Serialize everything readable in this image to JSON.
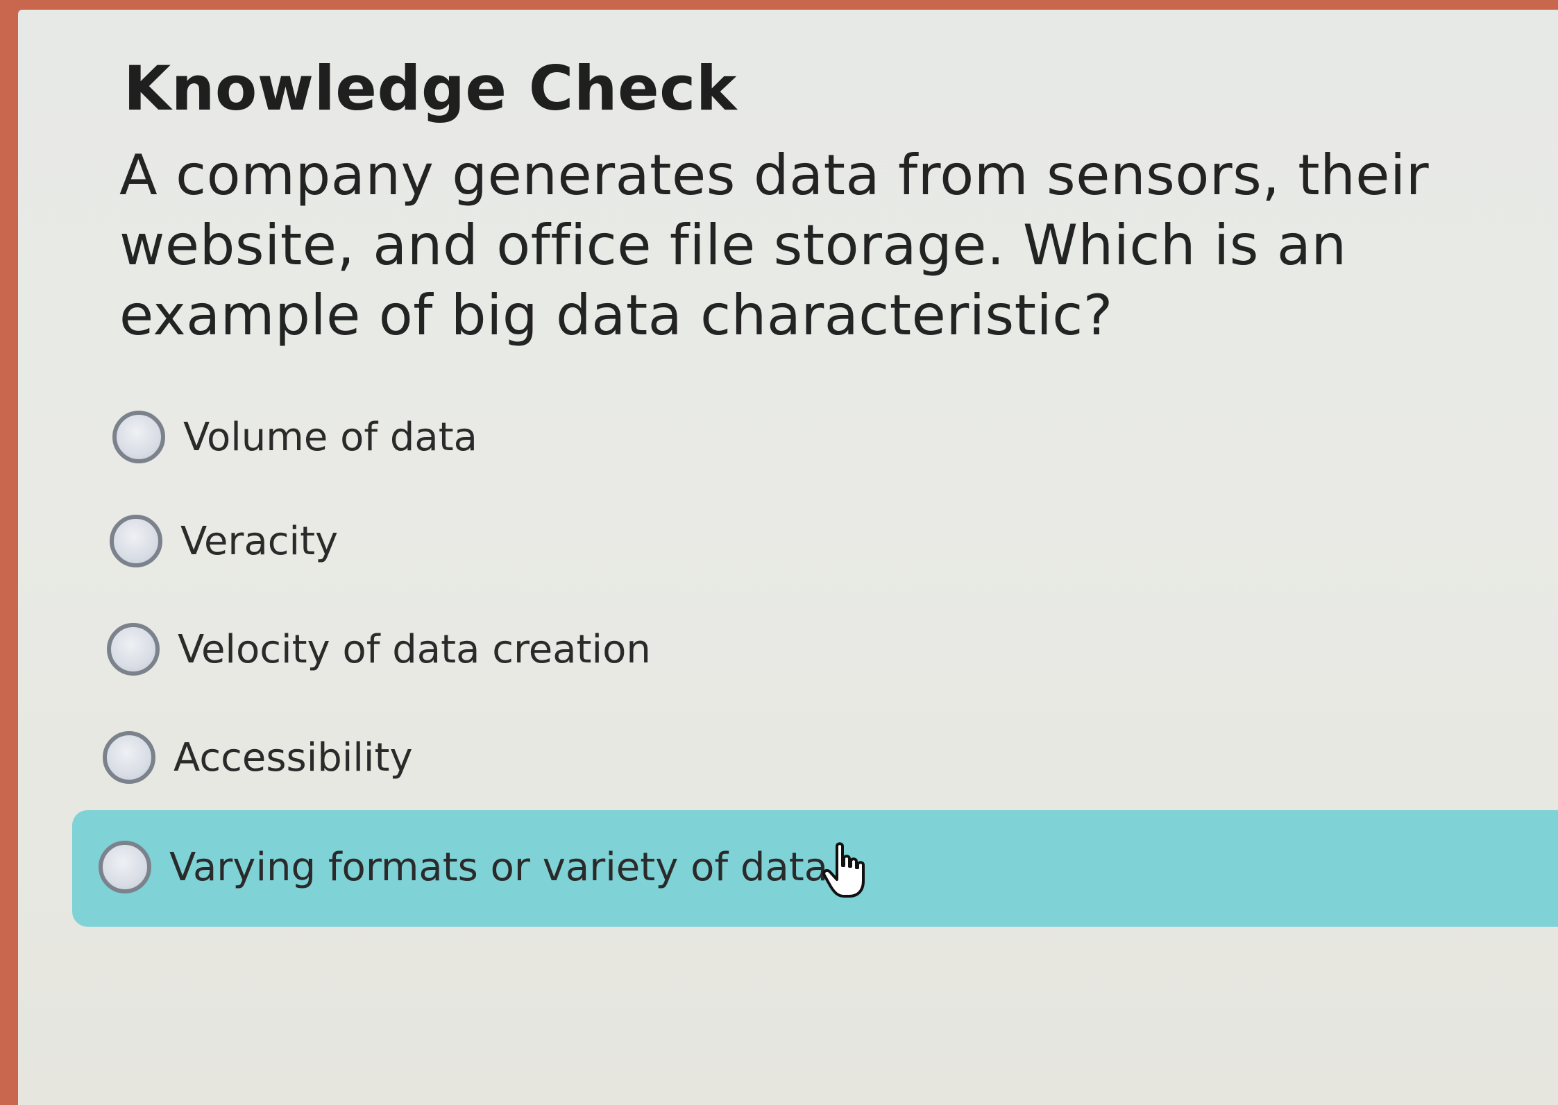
{
  "quiz": {
    "title": "Knowledge Check",
    "question": "A company generates data from sensors, their website, and office file storage. Which is an example of big data characteristic?",
    "options": [
      {
        "label": "Volume of data",
        "selected": false,
        "hovered": false
      },
      {
        "label": "Veracity",
        "selected": false,
        "hovered": false
      },
      {
        "label": "Velocity of data creation",
        "selected": false,
        "hovered": false
      },
      {
        "label": "Accessibility",
        "selected": false,
        "hovered": false
      },
      {
        "label": "Varying formats or variety of data",
        "selected": false,
        "hovered": true
      }
    ]
  },
  "colors": {
    "hover_highlight": "#7fd2d6",
    "page_background": "#e8e9e5",
    "radio_border": "#7c828c",
    "text": "#232323"
  },
  "icons": {
    "cursor": "hand-pointer-icon",
    "radio": "radio-unchecked-icon"
  }
}
